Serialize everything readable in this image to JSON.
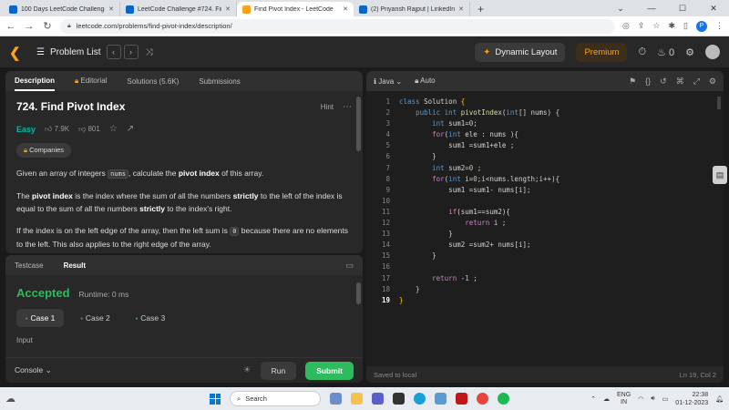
{
  "browser": {
    "tabs": [
      {
        "title": "100 Days LeetCode Challenge - ...",
        "color": "#0a66c2"
      },
      {
        "title": "LeetCode Challenge #724. Find ...",
        "color": "#0a66c2"
      },
      {
        "title": "Find Pivot Index - LeetCode",
        "color": "#ffa116"
      },
      {
        "title": "(2) Priyansh Rajput | LinkedIn",
        "color": "#0a66c2"
      }
    ],
    "url": "leetcode.com/problems/find-pivot-index/description/",
    "profile_initial": "P"
  },
  "lcnav": {
    "problem_list": "Problem List",
    "dynamic_layout": "Dynamic Layout",
    "premium": "Premium",
    "streak": "0"
  },
  "left": {
    "tabs": [
      "Description",
      "Editorial",
      "Solutions (5.6K)",
      "Submissions"
    ],
    "title": "724. Find Pivot Index",
    "hint": "Hint",
    "difficulty": "Easy",
    "likes": "7.9K",
    "dislikes": "801",
    "companies": "Companies",
    "p1_pre": "Given an array of integers ",
    "p1_code": "nums",
    "p1_mid": ", calculate the ",
    "p1_bold": "pivot index",
    "p1_post": " of this array.",
    "p2_a": "The ",
    "p2_b": "pivot index",
    "p2_c": " is the index where the sum of all the numbers ",
    "p2_d": "strictly",
    "p2_e": " to the left of the index is equal to the sum of all the numbers ",
    "p2_f": "strictly",
    "p2_g": " to the index's right.",
    "p3_a": "If the index is on the left edge of the array, then the left sum is ",
    "p3_code": "0",
    "p3_b": " because there are no elements to the left. This also applies to the right edge of the array."
  },
  "test": {
    "tabs": [
      "Testcase",
      "Result"
    ],
    "status": "Accepted",
    "runtime": "Runtime: 0 ms",
    "cases": [
      "Case 1",
      "Case 2",
      "Case 3"
    ],
    "input_label": "Input",
    "console": "Console",
    "run": "Run",
    "submit": "Submit"
  },
  "editor": {
    "language": "Java",
    "mode": "Auto",
    "saved": "Saved to local",
    "position": "Ln 19, Col 2"
  },
  "taskbar": {
    "search": "Search",
    "lang_line1": "ENG",
    "lang_line2": "IN",
    "time": "22:38",
    "date": "01-12-2023"
  }
}
